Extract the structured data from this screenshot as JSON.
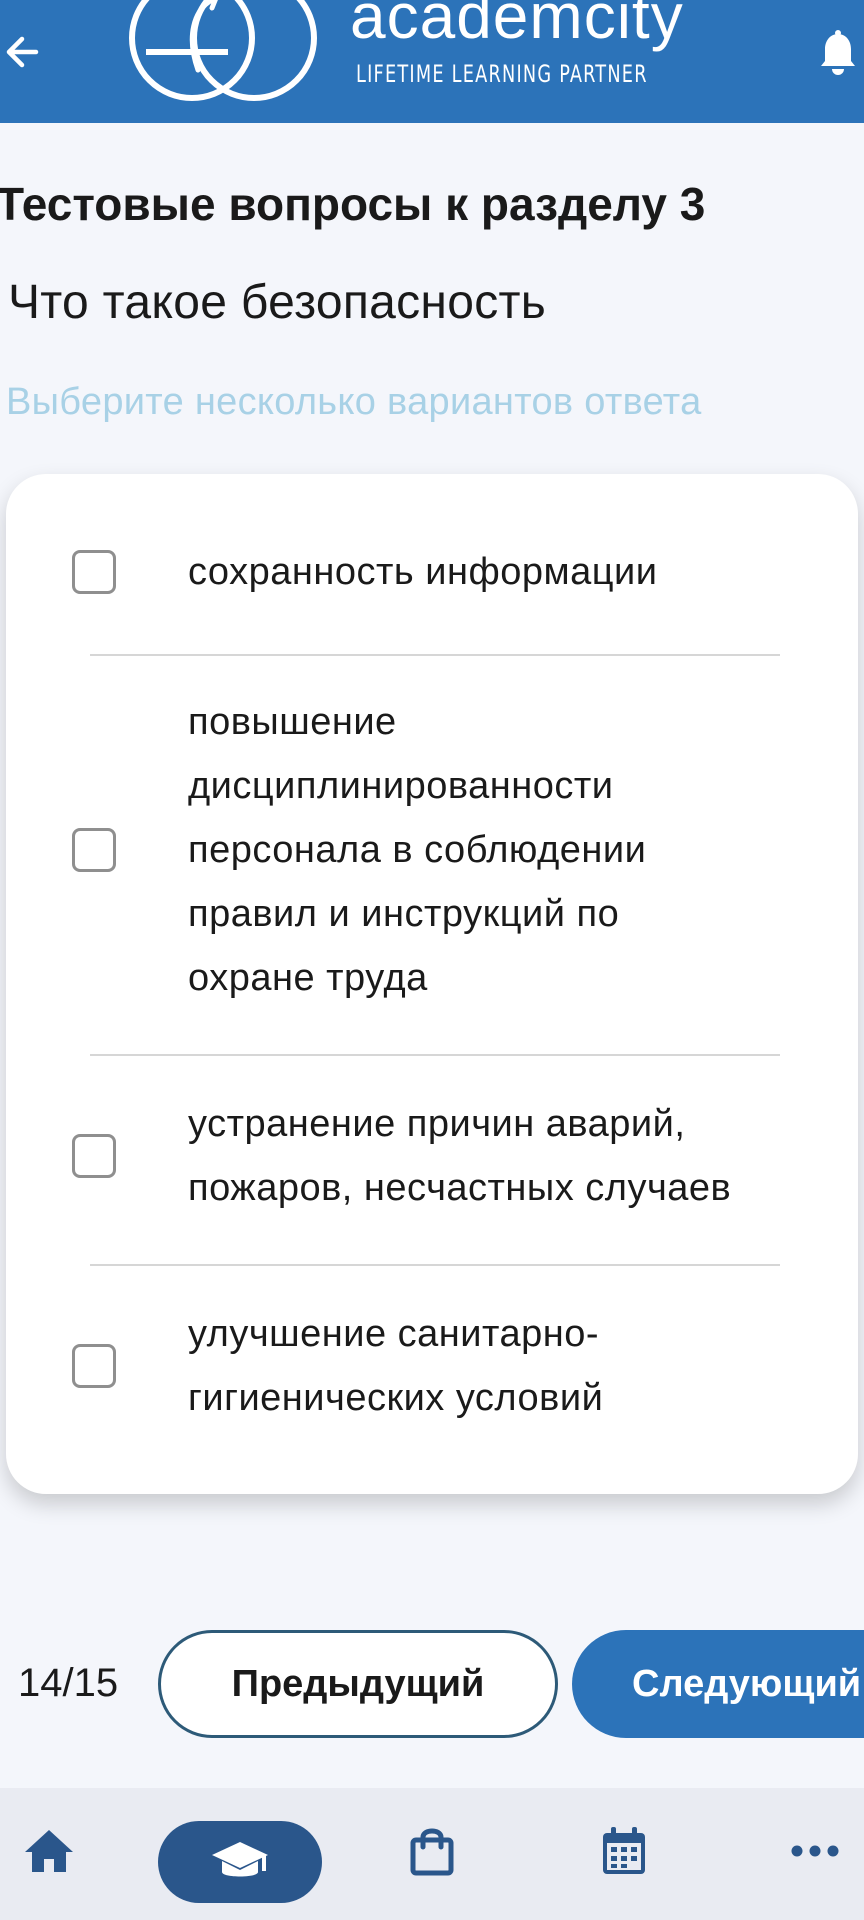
{
  "header": {
    "logo_name": "academcity",
    "logo_tagline": "LIFETIME LEARNING PARTNER"
  },
  "quiz": {
    "section_title": "Тестовые вопросы к разделу 3",
    "question": "Что такое безопасность",
    "hint": "Выберите несколько вариантов ответа",
    "options": [
      {
        "label": "сохранность информации",
        "checked": false
      },
      {
        "label": "повышение дисциплинированности персонала в соблюдении правил и инструкций по охране труда",
        "checked": false
      },
      {
        "label": "устранение причин аварий, пожаров, несчастных случаев",
        "checked": false
      },
      {
        "label": "улучшение санитарно-гигиенических условий",
        "checked": false
      }
    ]
  },
  "pagination": {
    "counter": "14/15",
    "prev_label": "Предыдущий",
    "next_label": "Следующий"
  },
  "bottom_nav": {
    "items": [
      {
        "icon": "home-icon",
        "active": false
      },
      {
        "icon": "graduation-cap-icon",
        "active": true
      },
      {
        "icon": "shopping-bag-icon",
        "active": false
      },
      {
        "icon": "calendar-icon",
        "active": false
      },
      {
        "icon": "more-icon",
        "active": false
      }
    ]
  },
  "colors": {
    "brand_blue": "#2c73b9",
    "nav_active": "#2a568b",
    "hint_color": "#a8d1e6"
  }
}
